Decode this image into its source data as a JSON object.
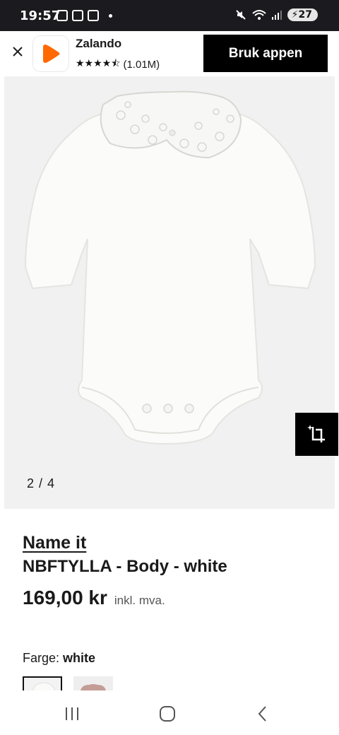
{
  "status_bar": {
    "time": "19:57",
    "battery_level": "27",
    "icons": [
      "calendar-icon",
      "screenshot-icon",
      "checkbox-icon",
      "notification-dot-icon",
      "mute-icon",
      "wifi-icon",
      "signal-icon",
      "battery-icon"
    ]
  },
  "app_banner": {
    "app_name": "Zalando",
    "stars": "★★★★⯪",
    "rating_count": "(1.01M)",
    "rating_value": 4.5,
    "cta_label": "Bruk appen",
    "brand_color": "#ff6900"
  },
  "gallery": {
    "counter": "2 / 4",
    "current_image": 2,
    "total_images": 4
  },
  "product": {
    "brand": "Name it",
    "name": "NBFTYLLA - Body - white",
    "price": "169,00 kr",
    "tax_note": "inkl. mva.",
    "color_label": "Farge:",
    "color_value": "white",
    "swatches": [
      "white",
      "rose"
    ]
  },
  "nav_bar": {
    "icons": [
      "recent-apps-icon",
      "home-icon",
      "back-icon"
    ]
  }
}
